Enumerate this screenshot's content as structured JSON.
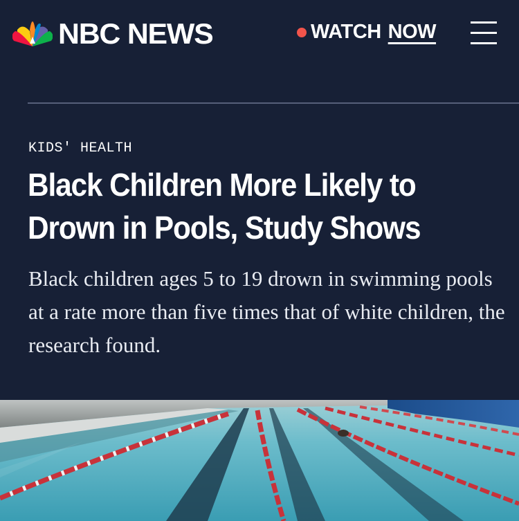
{
  "header": {
    "brand": "NBC NEWS",
    "logo_icon": "nbc-peacock-icon",
    "watch_label": "WATCH",
    "now_label": "NOW",
    "menu_icon": "hamburger-menu-icon"
  },
  "article": {
    "category": "KIDS' HEALTH",
    "headline": "Black Children More Likely to Drown in Pools, Study Shows",
    "dek": "Black children ages 5 to 19 drown in swimming pools at a rate more than five times that of white children, the research found."
  },
  "colors": {
    "background": "#172036",
    "text": "#ffffff",
    "live_dot": "#f2544b",
    "divider": "#56607a",
    "pool_water": "#5fb3c3",
    "lane_rope": "#c8323a"
  }
}
